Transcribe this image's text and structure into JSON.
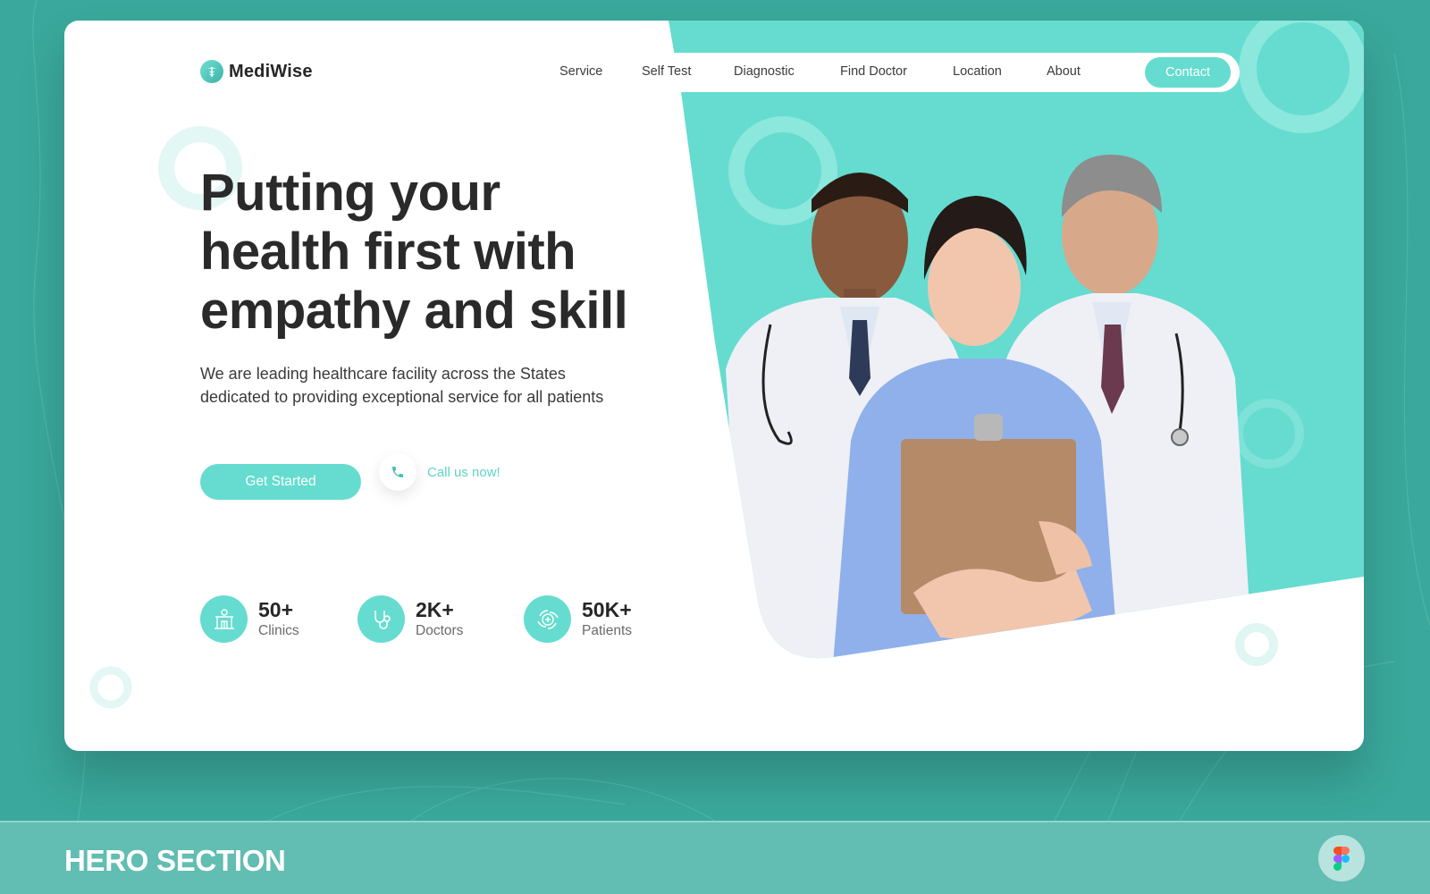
{
  "colors": {
    "accent": "#65dccf",
    "accent_dark": "#3aa89c",
    "text_dark": "#2a2a2a",
    "text_muted": "#6a6a6a",
    "footer_bg": "#62bdb2"
  },
  "brand": {
    "name": "MediWise",
    "icon": "caduceus-icon"
  },
  "nav": {
    "items": [
      {
        "label": "Service"
      },
      {
        "label": "Self Test"
      },
      {
        "label": "Diagnostic"
      },
      {
        "label": "Find Doctor"
      },
      {
        "label": "Location"
      },
      {
        "label": "About"
      }
    ],
    "contact_label": "Contact"
  },
  "hero": {
    "headline_lines": [
      "Putting your",
      "health first with",
      "empathy and skill"
    ],
    "subtext_lines": [
      "We are leading healthcare facility across the States",
      "dedicated to providing exceptional service for all patients"
    ],
    "primary_cta": "Get Started",
    "secondary_cta": "Call us now!",
    "secondary_icon": "phone-icon",
    "image_alt": "Three smiling medical professionals: two doctors in white coats with stethoscopes and a nurse in blue scrubs holding a clipboard"
  },
  "stats": [
    {
      "value": "50+",
      "label": "Clinics",
      "icon": "clinic-building-icon"
    },
    {
      "value": "2K+",
      "label": "Doctors",
      "icon": "stethoscope-icon"
    },
    {
      "value": "50K+",
      "label": "Patients",
      "icon": "care-hands-icon"
    }
  ],
  "footer": {
    "title": "HERO SECTION",
    "icon": "figma-icon"
  }
}
